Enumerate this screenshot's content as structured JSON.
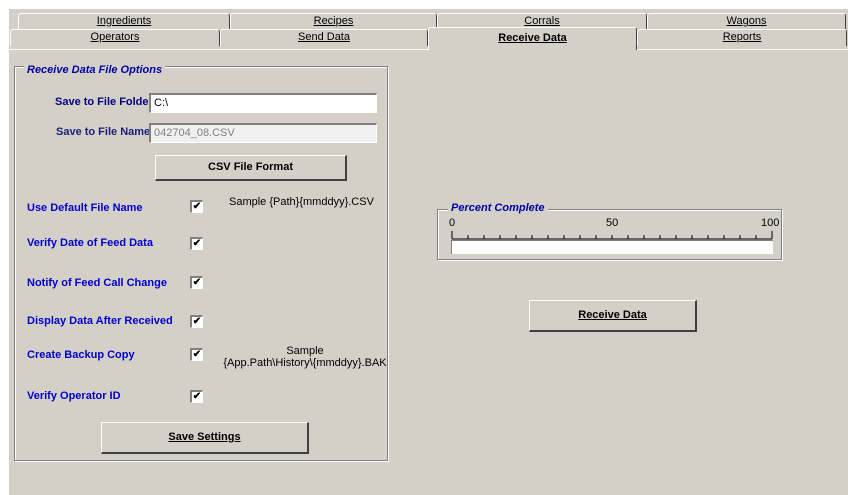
{
  "tabs": {
    "row1": [
      "Ingredients",
      "Recipes",
      "Corrals",
      "Wagons"
    ],
    "row2": [
      "Operators",
      "Send Data",
      "Receive Data",
      "Reports"
    ],
    "active": "Receive Data"
  },
  "options_group": {
    "legend": "Receive Data File Options",
    "folder_label": "Save to File Folder",
    "folder_value": "C:\\",
    "name_label": "Save to File Name",
    "name_value": "042704_08.CSV",
    "csv_button": "CSV File Format",
    "settings": [
      {
        "label": "Use Default File Name",
        "checked": true,
        "sample": "Sample  {Path}{mmddyy}.CSV"
      },
      {
        "label": "Verify Date of Feed Data",
        "checked": true
      },
      {
        "label": "Notify of Feed Call Change",
        "checked": true
      },
      {
        "label": "Display Data After Received",
        "checked": true
      },
      {
        "label": "Create Backup Copy",
        "checked": true,
        "sample_line1": "Sample",
        "sample_line2": "{App.Path\\History\\{mmddyy}.BAK"
      },
      {
        "label": "Verify Operator ID",
        "checked": true
      }
    ],
    "save_button": "Save Settings"
  },
  "progress": {
    "legend": "Percent Complete",
    "min_label": "0",
    "mid_label": "50",
    "max_label": "100",
    "percent": 0
  },
  "receive_button": "Receive Data",
  "check_glyph": "✔"
}
